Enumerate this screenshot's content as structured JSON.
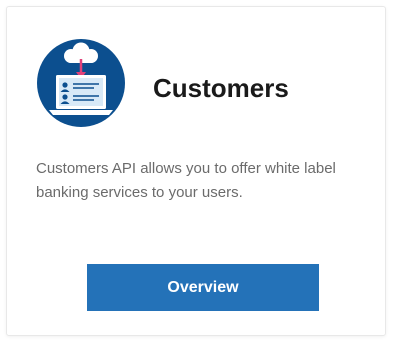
{
  "card": {
    "icon": "customers-api-icon",
    "title": "Customers",
    "description": "Customers API allows you to offer white label banking services to your users.",
    "button_label": "Overview"
  },
  "colors": {
    "accent": "#2472b8",
    "icon_circle": "#0c4f8f",
    "icon_arrow": "#e0427a"
  }
}
